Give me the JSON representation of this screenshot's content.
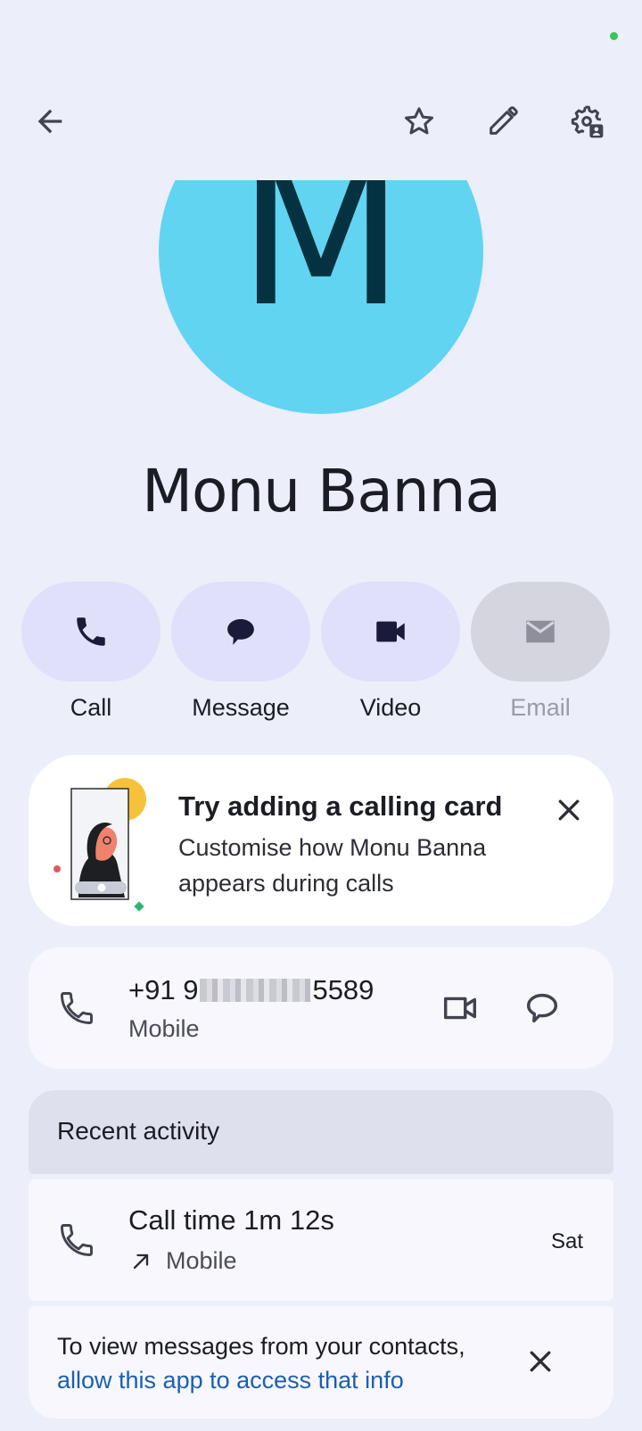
{
  "colors": {
    "background": "#eceef9",
    "accent_pill": "#e1e0fa",
    "avatar_bg": "#61d4f2",
    "avatar_letter": "#053240",
    "link": "#1a5fb4",
    "status_dot": "#34c759"
  },
  "topbar": {
    "back_icon": "arrow-left-icon",
    "favorite_icon": "star-outline-icon",
    "edit_icon": "pencil-icon",
    "settings_icon": "contact-settings-icon"
  },
  "contact": {
    "initial": "M",
    "name": "Monu Banna"
  },
  "actions": [
    {
      "label": "Call",
      "icon": "phone-icon",
      "enabled": true
    },
    {
      "label": "Message",
      "icon": "chat-bubble-icon",
      "enabled": true
    },
    {
      "label": "Video",
      "icon": "video-camera-icon",
      "enabled": true
    },
    {
      "label": "Email",
      "icon": "mail-icon",
      "enabled": false
    }
  ],
  "promo": {
    "title": "Try adding a calling card",
    "body": "Customise how Monu Banna appears during calls"
  },
  "phone": {
    "prefix": "+91 9",
    "suffix": "5589",
    "type": "Mobile"
  },
  "recent": {
    "header": "Recent activity",
    "call_title": "Call time 1m 12s",
    "call_type": "Mobile",
    "call_day": "Sat"
  },
  "permission": {
    "text": "To view messages from your contacts,",
    "link": "allow this app to access that info"
  }
}
